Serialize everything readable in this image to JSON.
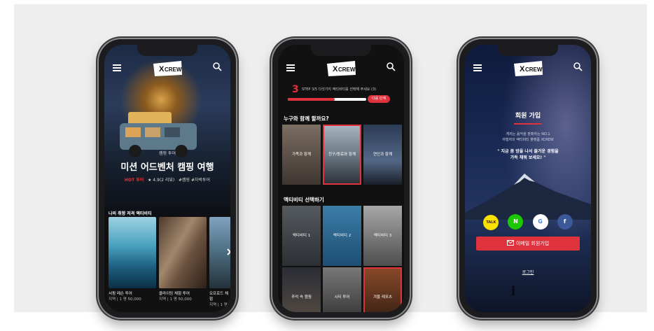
{
  "phone1": {
    "hero": {
      "tag": "캠핑 투어",
      "title": "미션 어드벤처 캠핑 여행",
      "meta_hot": "HOT 투어",
      "meta_rating": "★ 4.9(2 리뷰)",
      "meta_tags": "#캠핑 #차박투어"
    },
    "section_title": "나의 취향 저격 액티비티",
    "cards": [
      {
        "title": "서핑 레슨 투어",
        "sub": "지역 | 1 명 ",
        "price": "50,000"
      },
      {
        "title": "클라이밍 체험 투어",
        "sub": "지역 | 1 명 ",
        "price": "50,000"
      },
      {
        "title": "오프로드 체험",
        "sub": "지역 | 1 명"
      }
    ]
  },
  "phone2": {
    "step": "3",
    "step_desc": "STEP 3/5 다섯가지 액티비티를 선택해 주세요 (3)",
    "progress": 0.6,
    "next_label": "다음 단계",
    "q_companion": "누구와 함께 할까요?",
    "companions": [
      "가족과 함께",
      "친구/동료와 함께",
      "연인과 함께"
    ],
    "q_activity": "액티비티 선택하기",
    "activities": [
      "액티비티 1",
      "액티비티 2",
      "액티비티 3",
      "추억 속 캠핑",
      "시티 투어",
      "겨울 레포츠"
    ]
  },
  "phone3": {
    "title": "회원 가입",
    "desc_line1": "게저는 음악을 판매하는 NO.1",
    "desc_line2": "여행자의 액티비티 플랫폼 XCREW",
    "quote_line1": "\" 지금 좀 방을 나서 즐거운 경험을",
    "quote_line2": "가득 채워 보세요! \"",
    "social": {
      "kakao": "TALK",
      "naver": "N",
      "google": "G",
      "facebook": "f"
    },
    "email_button": "이메일 회원가입",
    "login": "로그인"
  },
  "brand": {
    "logo_top": "X",
    "logo_word": "CREW",
    "accent": "#e0323c"
  },
  "icons": {
    "menu": "hamburger-icon",
    "search": "search-icon",
    "email": "mail-icon",
    "next": "chevron-right-icon"
  }
}
